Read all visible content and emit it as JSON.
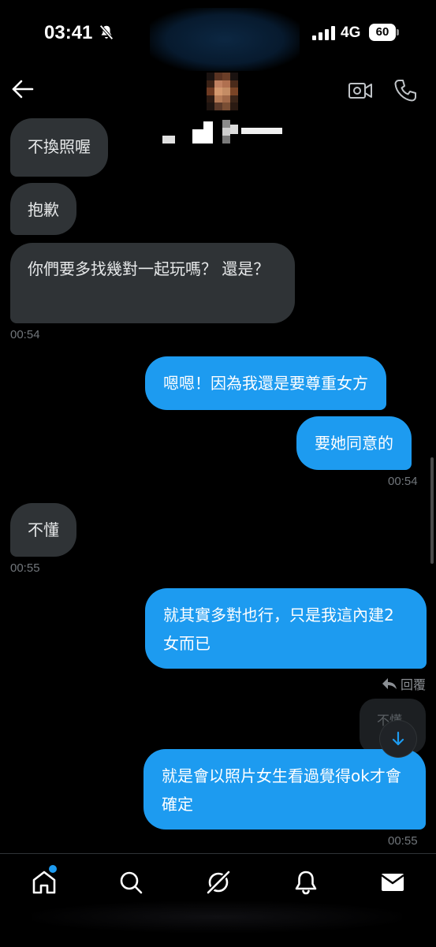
{
  "status_bar": {
    "time": "03:41",
    "network": "4G",
    "battery": "60",
    "icons": [
      "bell-slash-icon",
      "signal-icon",
      "battery-icon"
    ]
  },
  "header": {
    "contact_name": "",
    "icons": [
      "back-arrow-icon",
      "video-call-icon",
      "phone-icon"
    ]
  },
  "messages": [
    {
      "side": "received",
      "text": "不換照喔"
    },
    {
      "side": "received",
      "text": "抱歉"
    },
    {
      "side": "received",
      "text": "你們要多找幾對一起玩嗎？ 還是？"
    },
    {
      "side": "time",
      "text": "00:54"
    },
    {
      "side": "sent",
      "text": "嗯嗯！因為我還是要尊重女方"
    },
    {
      "side": "sent",
      "text": "要她同意的"
    },
    {
      "side": "time",
      "text": "00:54"
    },
    {
      "side": "received",
      "text": "不懂"
    },
    {
      "side": "time",
      "text": "00:55"
    },
    {
      "side": "sent",
      "text": "就其實多對也行，只是我這內建2女而已"
    },
    {
      "side": "sent",
      "text": "就是會以照片女生看過覺得ok才會確定"
    },
    {
      "side": "time",
      "text": "00:55"
    }
  ],
  "reply": {
    "label": "回覆",
    "icon": "reply-arrow-icon"
  },
  "ghost_text": "不懂",
  "bottom_nav": {
    "items": [
      "home-icon",
      "search-icon",
      "grok-icon",
      "bell-icon",
      "mail-icon"
    ],
    "active": "home-icon",
    "accent": "#1d9bf0"
  },
  "colors": {
    "sent_bubble": "#1d9bf0",
    "received_bubble": "#2f3336",
    "background": "#000000",
    "muted_text": "#71767b"
  }
}
